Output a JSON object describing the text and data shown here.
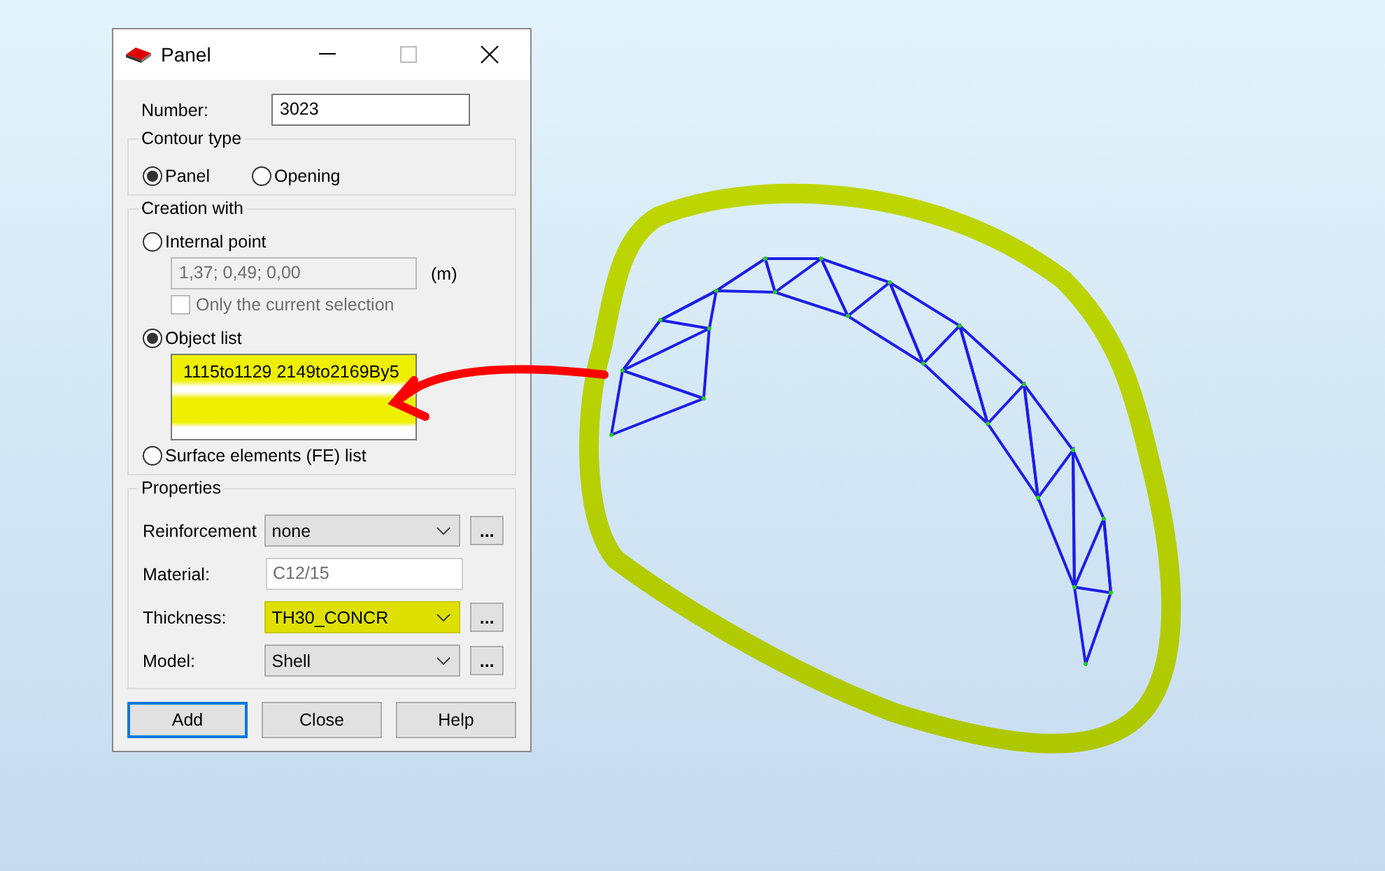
{
  "window": {
    "title": "Panel"
  },
  "number": {
    "label": "Number:",
    "value": "3023"
  },
  "contour_type": {
    "title": "Contour type",
    "options": [
      {
        "label": "Panel",
        "selected": true
      },
      {
        "label": "Opening",
        "selected": false
      }
    ]
  },
  "creation_with": {
    "title": "Creation with",
    "internal_point": {
      "label": "Internal point",
      "selected": false,
      "value": "1,37; 0,49; 0,00",
      "disabled": true,
      "unit": "(m)"
    },
    "current_selection": {
      "label": "Only the current selection",
      "checked": false,
      "disabled": true
    },
    "object_list": {
      "label": "Object list",
      "selected": true,
      "value": "1115to1129 2149to2169By5",
      "highlighted": true
    },
    "fe_list": {
      "label": "Surface elements (FE) list",
      "selected": false
    }
  },
  "properties": {
    "title": "Properties",
    "rows": [
      {
        "label": "Reinforcement",
        "kind": "combo",
        "value": "none",
        "more": "..."
      },
      {
        "label": "Material:",
        "kind": "readonly",
        "value": "C12/15"
      },
      {
        "label": "Thickness:",
        "kind": "combo",
        "value": "TH30_CONCR",
        "more": "...",
        "highlighted": true
      },
      {
        "label": "Model:",
        "kind": "combo",
        "value": "Shell",
        "more": "..."
      }
    ]
  },
  "buttons": [
    {
      "label": "Add",
      "default": true
    },
    {
      "label": "Close",
      "default": false
    },
    {
      "label": "Help",
      "default": false
    }
  ]
}
